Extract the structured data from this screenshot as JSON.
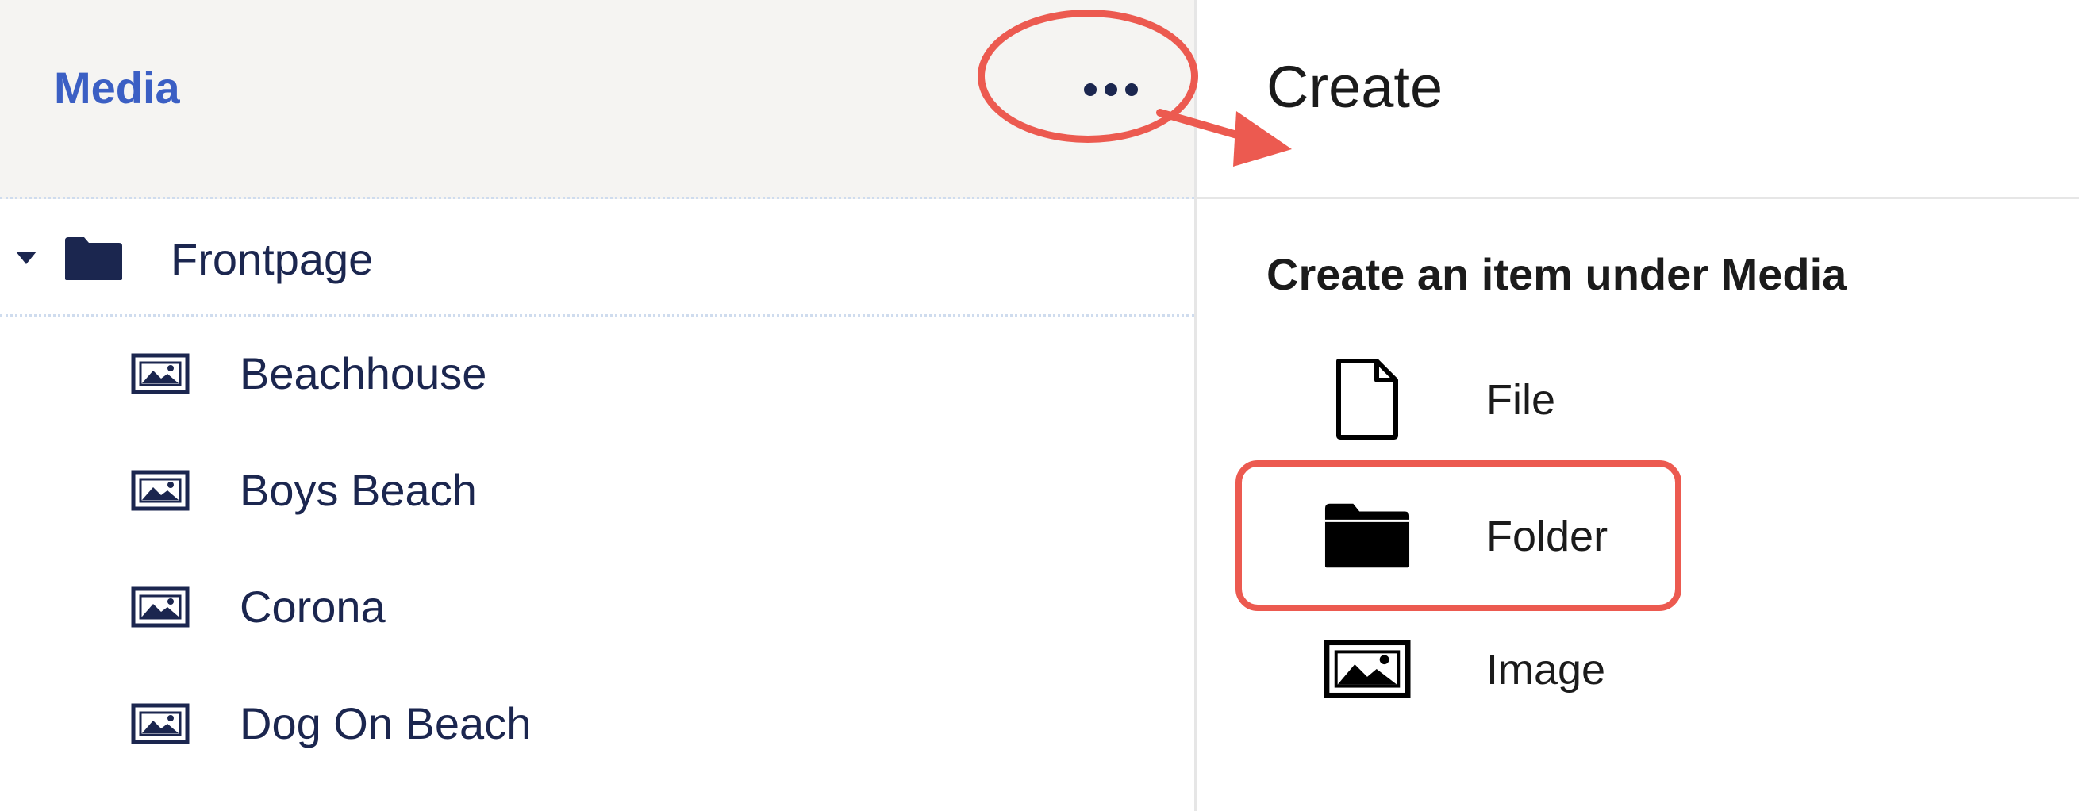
{
  "tree": {
    "title": "Media",
    "more_icon": "ellipsis-icon",
    "root": {
      "label": "Frontpage",
      "icon": "folder-icon",
      "expanded": true
    },
    "children": [
      {
        "label": "Beachhouse",
        "icon": "image-icon"
      },
      {
        "label": "Boys Beach",
        "icon": "image-icon"
      },
      {
        "label": "Corona",
        "icon": "image-icon"
      },
      {
        "label": "Dog On Beach",
        "icon": "image-icon"
      }
    ]
  },
  "create": {
    "title": "Create",
    "subtitle": "Create an item under Media",
    "options": [
      {
        "label": "File",
        "icon": "file-icon"
      },
      {
        "label": "Folder",
        "icon": "folder-icon",
        "highlighted": true
      },
      {
        "label": "Image",
        "icon": "image-icon"
      }
    ]
  },
  "colors": {
    "accent": "#3b5fc4",
    "tree_text": "#1b264f",
    "header_bg": "#f5f4f2",
    "annotation": "#ec5a50"
  }
}
